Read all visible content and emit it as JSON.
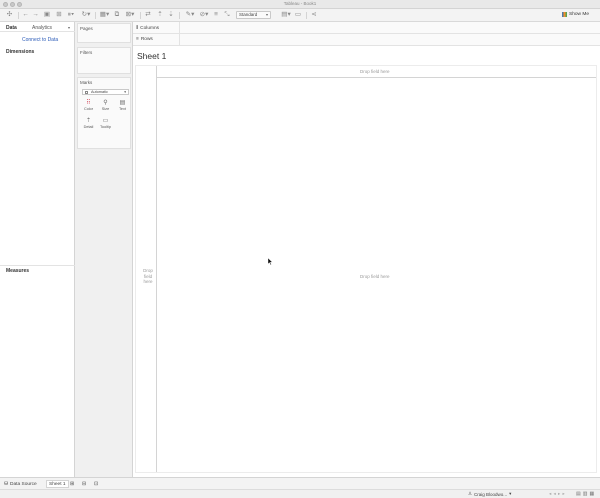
{
  "window": {
    "title": "Tableau - Book1"
  },
  "toolbar": {
    "standard_label": "Standard",
    "show_me_label": "Show Me",
    "icons": [
      "tableau-logo-icon",
      "undo-icon",
      "redo-icon",
      "save-icon",
      "new-datasource-icon",
      "pause-icon",
      "new-sheet-icon",
      "duplicate-icon",
      "clear-icon",
      "swap-icon",
      "sort-asc-icon",
      "sort-desc-icon",
      "highlight-icon",
      "group-icon",
      "labels-icon",
      "fix-axes-icon",
      "fit-icon",
      "presentation-icon",
      "share-icon"
    ]
  },
  "data_pane": {
    "tab_data": "Data",
    "tab_analytics": "Analytics",
    "connect_link": "Connect to Data",
    "dimensions_label": "Dimensions",
    "measures_label": "Measures"
  },
  "cards": {
    "pages_label": "Pages",
    "filters_label": "Filters",
    "marks_label": "Marks",
    "marks_type": "Automatic",
    "mark_buttons": {
      "color": "Color",
      "size": "Size",
      "text": "Text",
      "detail": "Detail",
      "tooltip": "Tooltip"
    }
  },
  "shelves": {
    "columns_label": "Columns",
    "rows_label": "Rows"
  },
  "sheet": {
    "title": "Sheet 1",
    "drop_field_cols": "Drop field here",
    "drop_field_center": "Drop field here",
    "drop_field_rows": "Drop field here"
  },
  "tabs": {
    "data_source": "Data Source",
    "sheet1": "Sheet 1"
  },
  "status": {
    "user": "Craig Bloodwo..."
  }
}
